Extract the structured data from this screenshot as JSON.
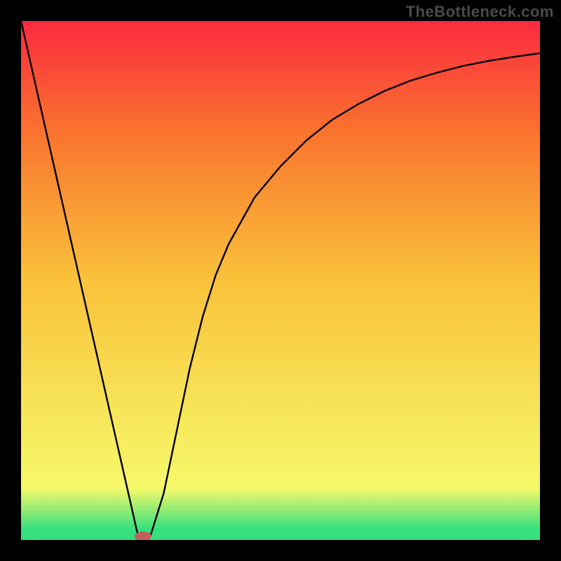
{
  "watermark": "TheBottleneck.com",
  "chart_data": {
    "type": "line",
    "title": "",
    "xlabel": "",
    "ylabel": "",
    "xlim": [
      0,
      100
    ],
    "ylim": [
      0,
      100
    ],
    "grid": false,
    "background_gradient": {
      "bottom": "#35E07D",
      "mid_bottom": "#F6F96A",
      "mid": "#F9C23A",
      "mid_top": "#F9752E",
      "top": "#FB2A3F"
    },
    "series": [
      {
        "name": "bottleneck-curve",
        "x": [
          0,
          5,
          10,
          15,
          20,
          22.5,
          25,
          27.5,
          30,
          32.5,
          35,
          37.5,
          40,
          45,
          50,
          55,
          60,
          65,
          70,
          75,
          80,
          85,
          90,
          95,
          100
        ],
        "y": [
          100,
          78,
          56,
          34,
          12,
          1,
          1,
          9,
          21,
          33,
          43,
          51,
          57,
          66,
          72,
          77,
          81,
          84,
          86.5,
          88.5,
          90,
          91.3,
          92.3,
          93.1,
          93.8
        ]
      }
    ],
    "marker": {
      "name": "optimal-point",
      "x": 23.5,
      "y": 0.7,
      "color": "#C1615E",
      "rx": 12,
      "ry": 7
    }
  }
}
